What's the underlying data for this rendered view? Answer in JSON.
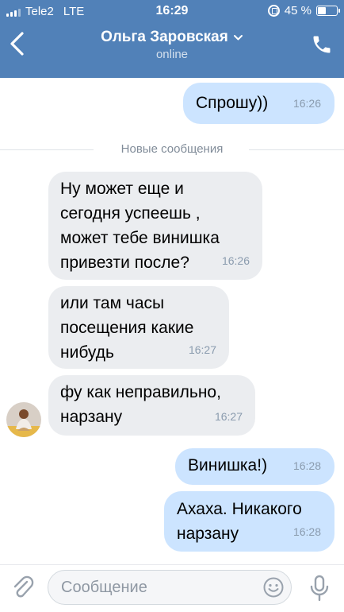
{
  "status_bar": {
    "carrier": "Tele2",
    "network": "LTE",
    "time": "16:29",
    "battery": "45 %",
    "battery_level_percent": 45
  },
  "header": {
    "contact_name": "Ольга Заровская",
    "status": "online",
    "icons": [
      "back-arrow-icon",
      "chevron-down-icon",
      "phone-icon"
    ]
  },
  "divider": {
    "label": "Новые сообщения"
  },
  "messages": [
    {
      "direction": "out",
      "text": "Спрошу))",
      "time": "16:26"
    },
    {
      "direction": "in",
      "text": "Ну может еще и\nсегодня успеешь ,\nможет тебе винишка\nпривезти после?",
      "time": "16:26"
    },
    {
      "direction": "in",
      "text": "или там часы\nпосещения какие\nнибудь",
      "time": "16:27"
    },
    {
      "direction": "in",
      "text": "фу как неправильно,\nнарзану",
      "time": "16:27"
    },
    {
      "direction": "out",
      "text": "Винишка!)",
      "time": "16:28"
    },
    {
      "direction": "out",
      "text": "Ахаха. Никакого\nнарзану",
      "time": "16:28"
    }
  ],
  "composer": {
    "placeholder": "Сообщение",
    "icons": [
      "paperclip-icon",
      "smile-icon",
      "microphone-icon"
    ]
  },
  "colors": {
    "header_bg": "#5181b8",
    "outgoing_bubble": "#cce4ff",
    "incoming_bubble": "#ebedf0",
    "timestamp": "#8a9bae"
  }
}
